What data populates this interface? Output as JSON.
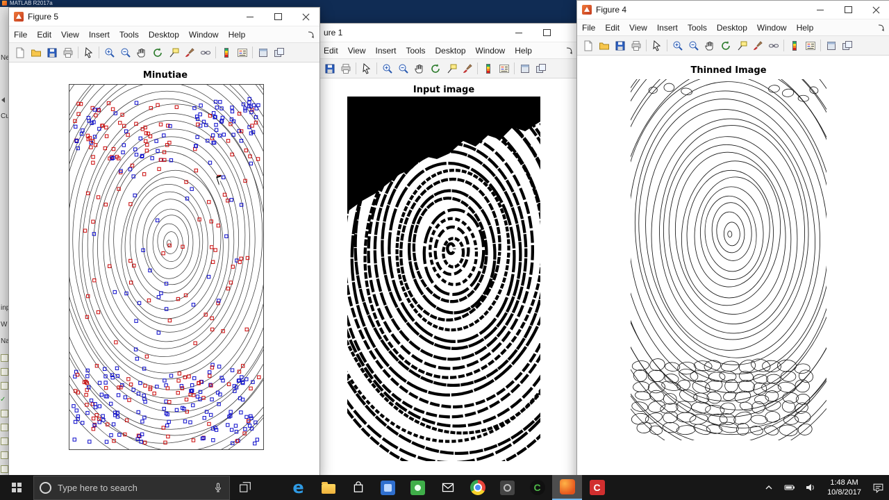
{
  "matlab": {
    "window_title": "MATLAB R2017a",
    "left_rail": {
      "labels": [
        "Ne",
        "Cu",
        "inp",
        "W",
        "Na"
      ]
    }
  },
  "figure5": {
    "window_title": "Figure 5",
    "menu": [
      "File",
      "Edit",
      "View",
      "Insert",
      "Tools",
      "Desktop",
      "Window",
      "Help"
    ],
    "plot_title": "Minutiae",
    "marker_colors": {
      "red": "#cc1111",
      "blue": "#1212cc"
    }
  },
  "figure1": {
    "window_title": "ure 1",
    "menu": [
      "Edit",
      "View",
      "Insert",
      "Tools",
      "Desktop",
      "Window",
      "Help"
    ],
    "plot_title": "Input image"
  },
  "figure4": {
    "window_title": "Figure 4",
    "menu": [
      "File",
      "Edit",
      "View",
      "Insert",
      "Tools",
      "Desktop",
      "Window",
      "Help"
    ],
    "plot_title": "Thinned Image"
  },
  "taskbar": {
    "search_placeholder": "Type here to search",
    "clock": {
      "time": "1:48 AM",
      "date": "10/8/2017"
    },
    "app_glyphs": {
      "edge": "e",
      "camtasia": "C",
      "recorder": "C"
    }
  }
}
